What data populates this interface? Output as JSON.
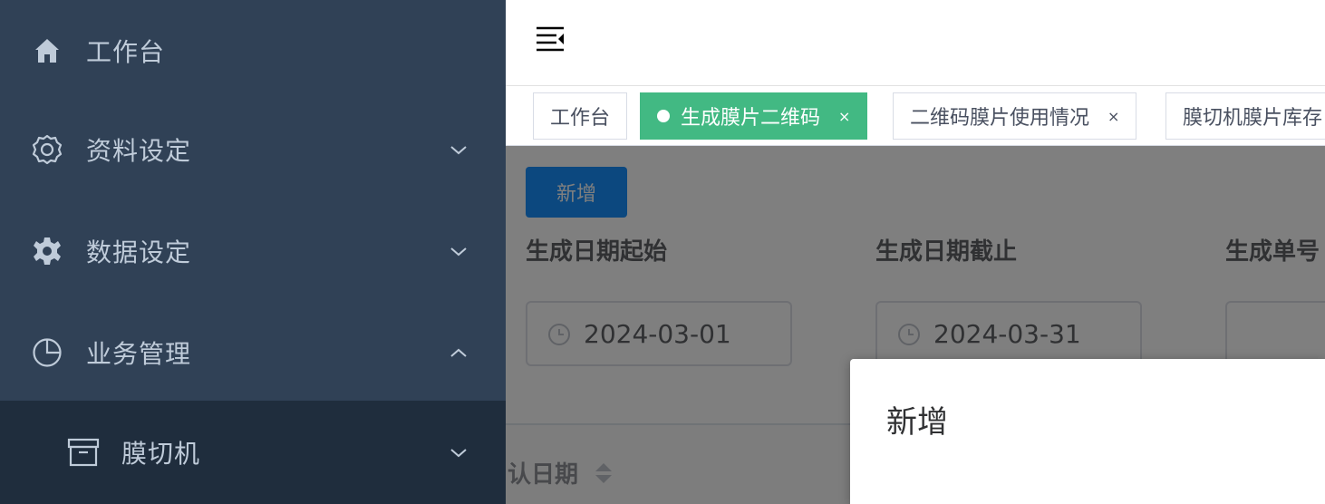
{
  "sidebar": {
    "items": [
      {
        "label": "工作台",
        "icon": "home-icon"
      },
      {
        "label": "资料设定",
        "icon": "settings-outline-icon",
        "arrow": "chevron-down-icon"
      },
      {
        "label": "数据设定",
        "icon": "gear-icon",
        "arrow": "chevron-down-icon"
      },
      {
        "label": "业务管理",
        "icon": "pie-chart-icon",
        "arrow": "chevron-up-icon"
      },
      {
        "label": "膜切机",
        "icon": "archive-box-icon",
        "arrow": "chevron-down-icon"
      }
    ],
    "colors": {
      "background": "#304156",
      "submenu_background": "#1f2d3d",
      "text": "#bfcbd9"
    }
  },
  "navbar": {
    "toggle_icon": "menu-fold-icon"
  },
  "tags": [
    {
      "label": "工作台",
      "active": false
    },
    {
      "label": "生成膜片二维码",
      "active": true,
      "close": "×"
    },
    {
      "label": "二维码膜片使用情况",
      "active": false,
      "close": "×"
    },
    {
      "label": "膜切机膜片库存",
      "active": false
    }
  ],
  "tag_active_color": "#42b983",
  "toolbar": {
    "add_label": "新增"
  },
  "filters": {
    "start_label": "生成日期起始",
    "start_value": "2024-03-01",
    "end_label": "生成日期截止",
    "end_value": "2024-03-31",
    "order_label": "生成单号",
    "order_value": ""
  },
  "table": {
    "partial_header": "认日期"
  },
  "dialog": {
    "title": "新增"
  }
}
